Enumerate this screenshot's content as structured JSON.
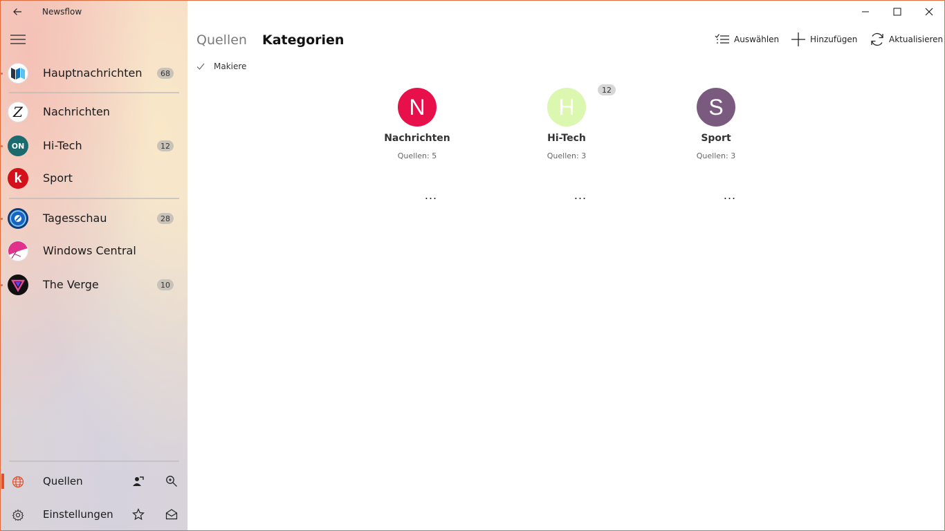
{
  "app": {
    "title": "Newsflow"
  },
  "sidebar": {
    "feeds": [
      {
        "label": "Hauptnachrichten",
        "count": "68",
        "icon": "hauptnachrichten-logo-icon"
      },
      {
        "label": "Nachrichten",
        "count": "",
        "icon": "zeit-logo-icon"
      },
      {
        "label": "Hi-Tech",
        "count": "12",
        "icon": "on-logo-icon"
      },
      {
        "label": "Sport",
        "count": "",
        "icon": "kicker-logo-icon"
      },
      {
        "label": "Tagesschau",
        "count": "28",
        "icon": "tagesschau-logo-icon"
      },
      {
        "label": "Windows Central",
        "count": "",
        "icon": "windows-central-logo-icon"
      },
      {
        "label": "The Verge",
        "count": "10",
        "icon": "verge-logo-icon"
      }
    ],
    "bottom": {
      "sources_label": "Quellen",
      "settings_label": "Einstellungen"
    },
    "logo_text": {
      "zeit": "Z",
      "on": "ON",
      "kicker": "k"
    }
  },
  "tabs": {
    "sources": "Quellen",
    "categories": "Kategorien"
  },
  "commands": {
    "select": "Auswählen",
    "add": "Hinzufügen",
    "refresh": "Aktualisieren"
  },
  "filter": {
    "label": "Makiere"
  },
  "categories": [
    {
      "initial": "N",
      "name": "Nachrichten",
      "sources": "Quellen: 5",
      "badge": "",
      "color": "#e8104a"
    },
    {
      "initial": "H",
      "name": "Hi-Tech",
      "sources": "Quellen: 3",
      "badge": "12",
      "color": "#dcf7b0"
    },
    {
      "initial": "S",
      "name": "Sport",
      "sources": "Quellen: 3",
      "badge": "",
      "color": "#7b5a80"
    }
  ],
  "more_label": "...",
  "colors": {
    "accent": "#e0502c",
    "window_border": "#e06a3c"
  }
}
